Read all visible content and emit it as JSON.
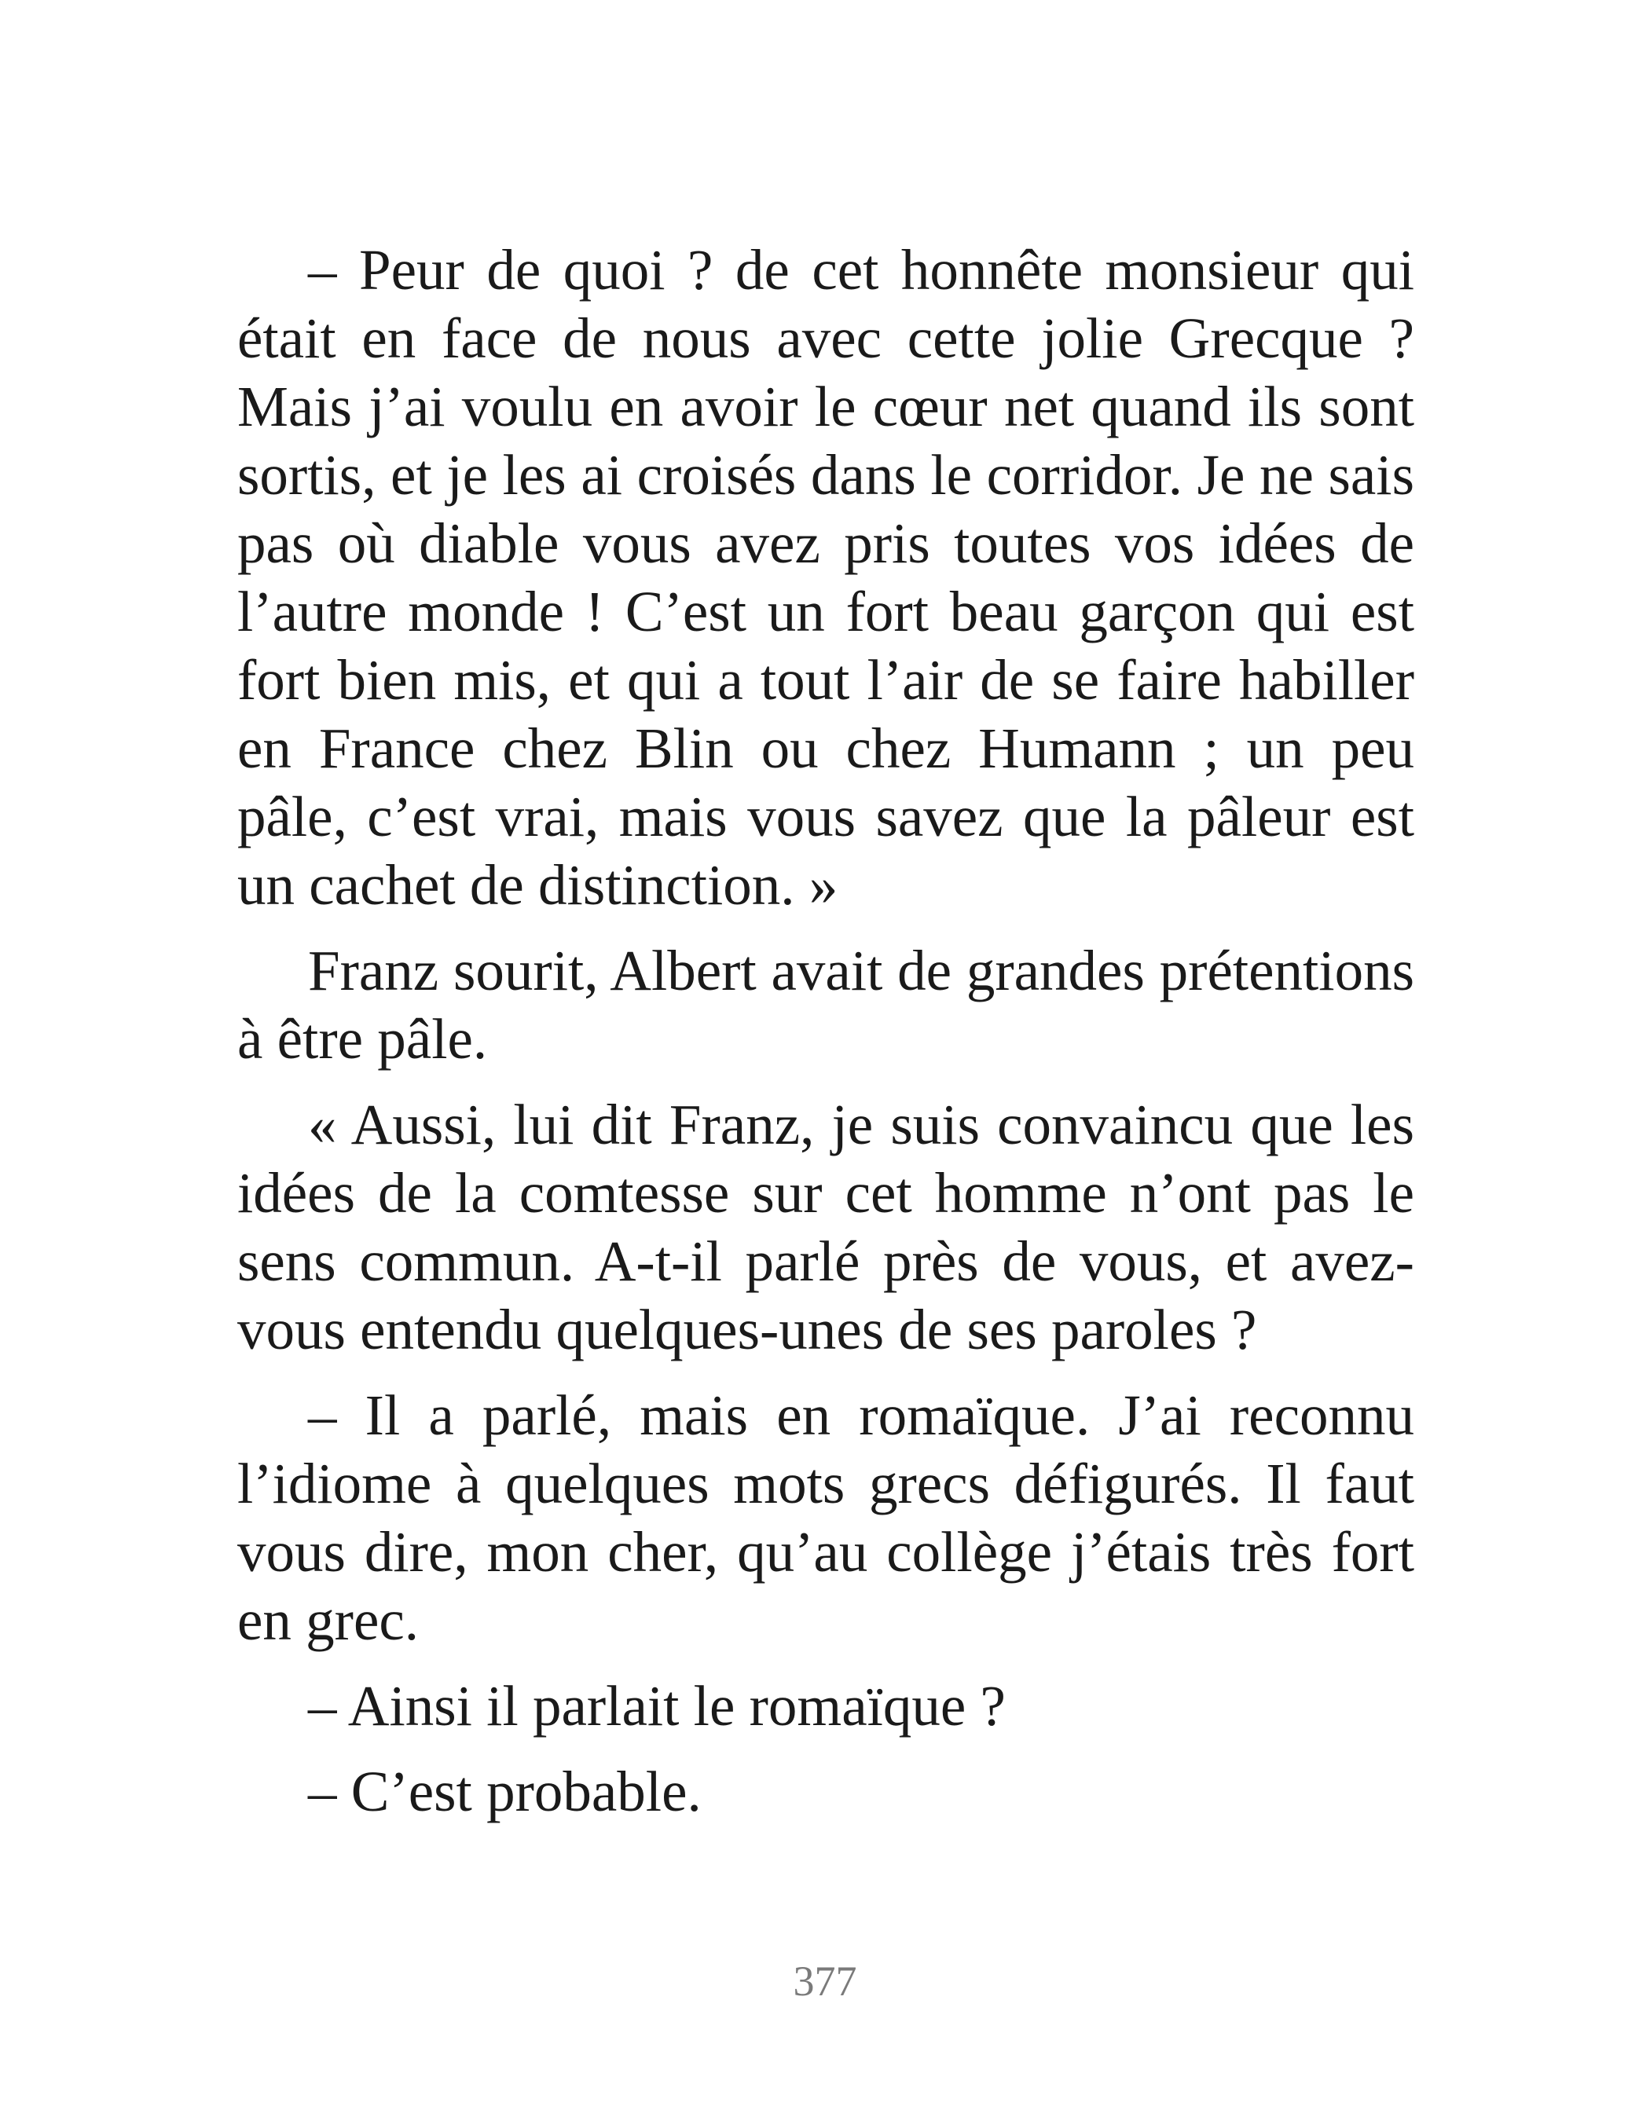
{
  "paragraphs": [
    "– Peur de quoi ? de cet honnête monsieur qui était en face de nous avec cette jolie Grecque ? Mais j’ai voulu en avoir le cœur net quand ils sont sortis, et je les ai croisés dans le corridor. Je ne sais pas où diable vous avez pris toutes vos idées de l’autre monde ! C’est un fort beau garçon qui est fort bien mis, et qui a tout l’air de se faire habiller en France chez Blin ou chez Humann ; un peu pâle, c’est vrai, mais vous savez que la pâleur est un cachet de distinction. »",
    "Franz sourit, Albert avait de grandes prétentions à être pâle.",
    "« Aussi, lui dit Franz, je suis convaincu que les idées de la comtesse sur cet homme n’ont pas le sens commun. A-t-il parlé près de vous, et avez-vous entendu quelques-unes de ses paroles ?",
    "– Il a parlé, mais en romaïque. J’ai reconnu l’idiome à quelques mots grecs défigurés. Il faut vous dire, mon cher, qu’au collège j’étais très fort en grec.",
    "– Ainsi il parlait le romaïque ?",
    "– C’est probable."
  ],
  "page_number": "377"
}
